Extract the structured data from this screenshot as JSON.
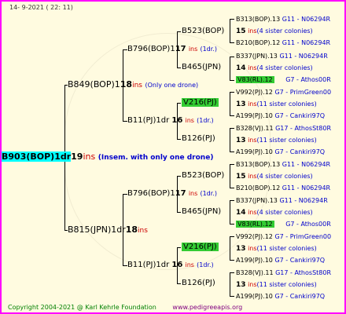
{
  "header": {
    "date": "14-  9-2021  ( 22: 11)"
  },
  "root": {
    "name": "B903(BOP)1dr",
    "ins_num": "19",
    "ins": "ins",
    "note": "(Insem. with only one drone)"
  },
  "g1": {
    "sire": {
      "name": "B849(BOP)1",
      "ins_num": "18",
      "ins": "ins",
      "note": "(Only one drone)"
    },
    "dam": {
      "name": "B815(JPN)1dr",
      "ins_num": "18",
      "ins": "ins"
    }
  },
  "g2": {
    "a": {
      "name": "B796(BOP)1",
      "ins_num": "17",
      "ins": "ins",
      "note": "(1dr.)"
    },
    "b": {
      "name": "B11(PJ)1dr",
      "ins_num": "16",
      "ins": "ins",
      "note": "(1dr.)"
    },
    "c": {
      "name": "B796(BOP)1",
      "ins_num": "17",
      "ins": "ins",
      "note": "(1dr.)"
    },
    "d": {
      "name": "B11(PJ)1dr",
      "ins_num": "16",
      "ins": "ins",
      "note": "(1dr.)"
    }
  },
  "g3": {
    "a1": "B523(BOP)",
    "a2": "B465(JPN)",
    "b1": "V216(PJ)",
    "b2": "B126(PJ)",
    "c1": "B523(BOP)",
    "c2": "B465(JPN)",
    "d1": "V216(PJ)",
    "d2": "B126(PJ)"
  },
  "g4": [
    {
      "top": "B313(BOP).13",
      "top_code": "G11 - N06294R",
      "num": "15",
      "ins": "ins",
      "note": "(4 sister colonies)",
      "bot": "B210(BOP).12",
      "bot_code": "G11 - N06294R"
    },
    {
      "top": "B337(JPN).13",
      "top_code": "G11 - N06294R",
      "num": "14",
      "ins": "ins",
      "note": "(4 sister colonies)",
      "bot": "V83(RL).12",
      "bot_code": "G7 - Athos00R"
    },
    {
      "top": "V992(PJ).12",
      "top_code": "G7 - PrimGreen00",
      "num": "13",
      "ins": "ins",
      "note": "(11 sister colonies)",
      "bot": "A199(PJ).10",
      "bot_code": "G7 - Cankiri97Q"
    },
    {
      "top": "B328(VJ).11",
      "top_code": "G17 - AthosSt80R",
      "num": "13",
      "ins": "ins",
      "note": "(11 sister colonies)",
      "bot": "A199(PJ).10",
      "bot_code": "G7 - Cankiri97Q"
    },
    {
      "top": "B313(BOP).13",
      "top_code": "G11 - N06294R",
      "num": "15",
      "ins": "ins",
      "note": "(4 sister colonies)",
      "bot": "B210(BOP).12",
      "bot_code": "G11 - N06294R"
    },
    {
      "top": "B337(JPN).13",
      "top_code": "G11 - N06294R",
      "num": "14",
      "ins": "ins",
      "note": "(4 sister colonies)",
      "bot": "V83(RL).12",
      "bot_code": "G7 - Athos00R"
    },
    {
      "top": "V992(PJ).12",
      "top_code": "G7 - PrimGreen00",
      "num": "13",
      "ins": "ins",
      "note": "(11 sister colonies)",
      "bot": "A199(PJ).10",
      "bot_code": "G7 - Cankiri97Q"
    },
    {
      "top": "B328(VJ).11",
      "top_code": "G17 - AthosSt80R",
      "num": "13",
      "ins": "ins",
      "note": "(11 sister colonies)",
      "bot": "A199(PJ).10",
      "bot_code": "G7 - Cankiri97Q"
    }
  ],
  "footer": {
    "copyright": "Copyright 2004-2021 @ Karl Kehrle Foundation",
    "url": "www.pedigreeapis.org"
  }
}
